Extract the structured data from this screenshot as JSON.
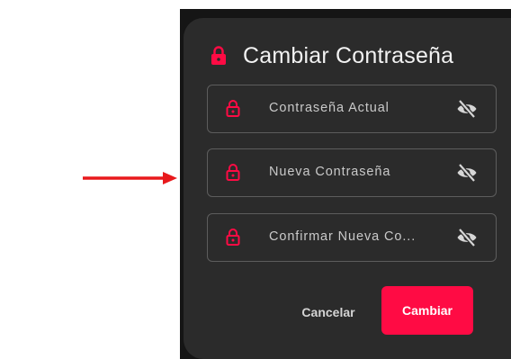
{
  "annotation": {
    "arrow_color": "#e8191c"
  },
  "dialog": {
    "title": "Cambiar Contraseña",
    "title_icon": "lock-icon",
    "accent_color": "#ff0b44",
    "fields": [
      {
        "label": "Contraseña Actual",
        "leading_icon": "lock-icon",
        "trailing_icon": "eye-off-icon"
      },
      {
        "label": "Nueva Contraseña",
        "leading_icon": "lock-icon",
        "trailing_icon": "eye-off-icon"
      },
      {
        "label": "Confirmar Nueva Co...",
        "leading_icon": "lock-icon",
        "trailing_icon": "eye-off-icon"
      }
    ],
    "cancel_label": "Cancelar",
    "submit_label": "Cambiar"
  }
}
